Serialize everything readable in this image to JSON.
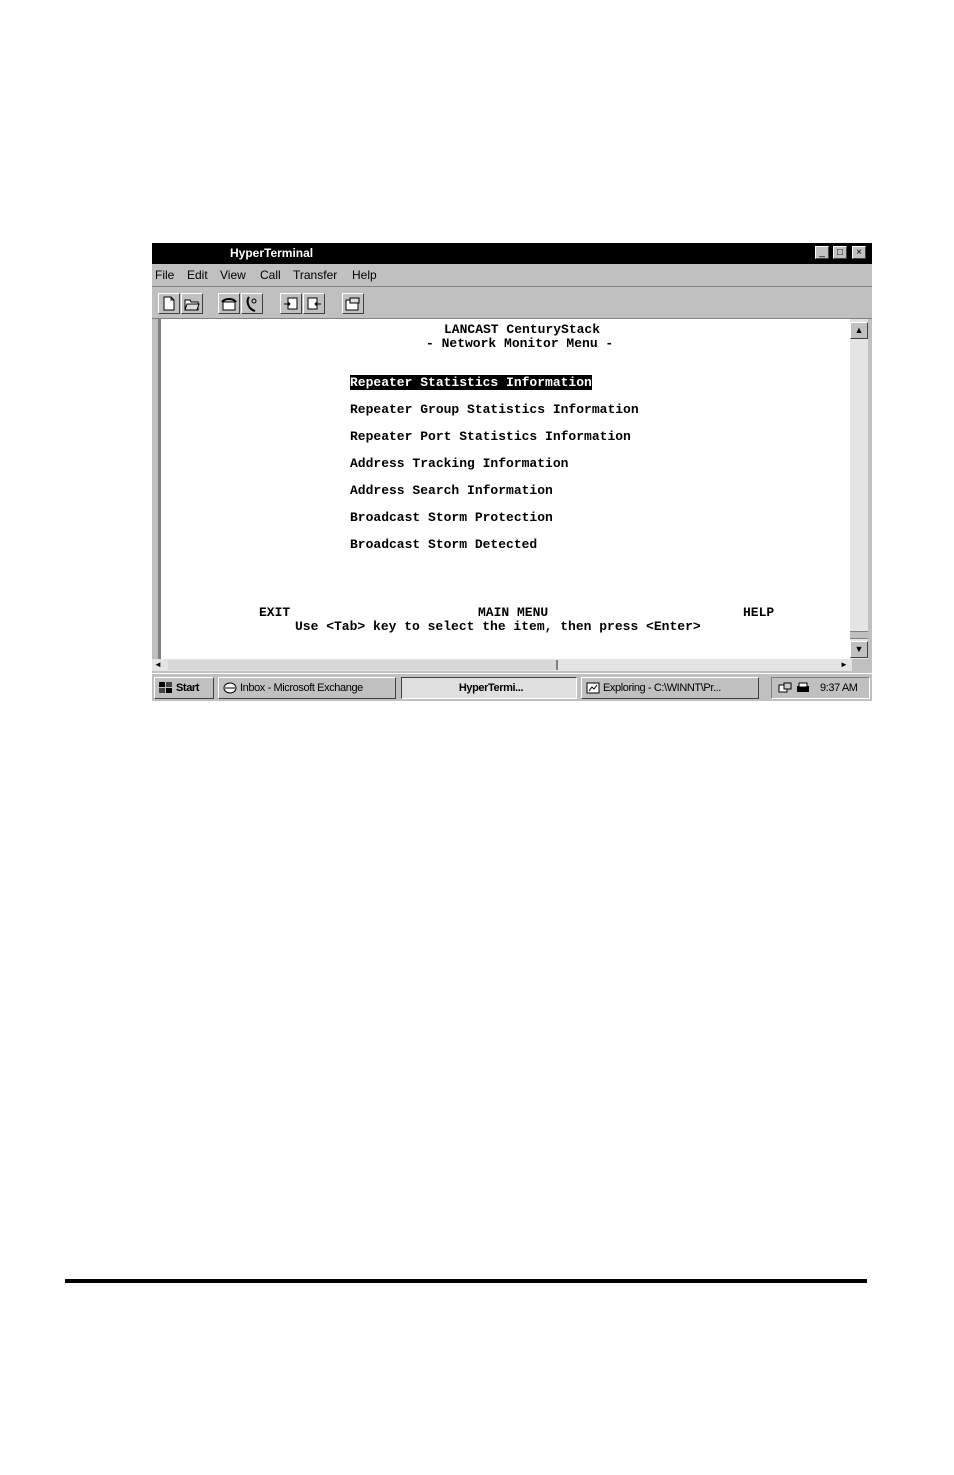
{
  "window": {
    "title": "HyperTerminal",
    "controls": {
      "minimize": "_",
      "maximize": "□",
      "close": "×"
    }
  },
  "menubar": {
    "items": [
      {
        "label": "File",
        "icon": ""
      },
      {
        "label": "Edit",
        "icon": ""
      },
      {
        "label": "View",
        "icon": ""
      },
      {
        "label": "Call",
        "icon": ""
      },
      {
        "label": "Transfer",
        "icon": ""
      },
      {
        "label": "Help",
        "icon": ""
      }
    ]
  },
  "toolbar": {
    "buttons": [
      {
        "icon": "new-document-icon"
      },
      {
        "icon": "open-folder-icon"
      },
      {
        "icon": "dial-phone-icon"
      },
      {
        "icon": "disconnect-phone-icon"
      },
      {
        "icon": "send-file-icon"
      },
      {
        "icon": "receive-file-icon"
      },
      {
        "icon": "properties-icon"
      }
    ]
  },
  "terminal": {
    "header_line1": "LANCAST CenturyStack",
    "header_line2": "- Network Monitor Menu -",
    "menu_items": [
      {
        "label": "Repeater Statistics Information",
        "selected": true
      },
      {
        "label": "Repeater Group Statistics Information",
        "selected": false
      },
      {
        "label": "Repeater Port Statistics Information",
        "selected": false
      },
      {
        "label": "Address Tracking Information",
        "selected": false
      },
      {
        "label": "Address Search Information",
        "selected": false
      },
      {
        "label": "Broadcast Storm Protection",
        "selected": false
      },
      {
        "label": "Broadcast Storm Detected",
        "selected": false
      }
    ],
    "footer_exit": "EXIT",
    "footer_main": "MAIN MENU",
    "footer_help": "HELP",
    "instruction": "Use <Tab> key to select the item, then press <Enter>"
  },
  "scrollbars": {
    "up": "▲",
    "down": "▼",
    "left": "◄",
    "right": "►"
  },
  "taskbar": {
    "start_label": "Start",
    "tasks": [
      {
        "label": "Inbox - Microsoft Exchange",
        "icon": "inbox-icon",
        "active": false
      },
      {
        "label": "HyperTermi...",
        "icon": "",
        "active": true
      },
      {
        "label": "Exploring - C:\\WINNT\\Pr...",
        "icon": "explorer-icon",
        "active": false
      }
    ],
    "clock": "9:37 AM"
  },
  "colors": {
    "titlebar": "#000000",
    "chrome": "#c0c0c0",
    "terminal_bg": "#ffffff"
  }
}
